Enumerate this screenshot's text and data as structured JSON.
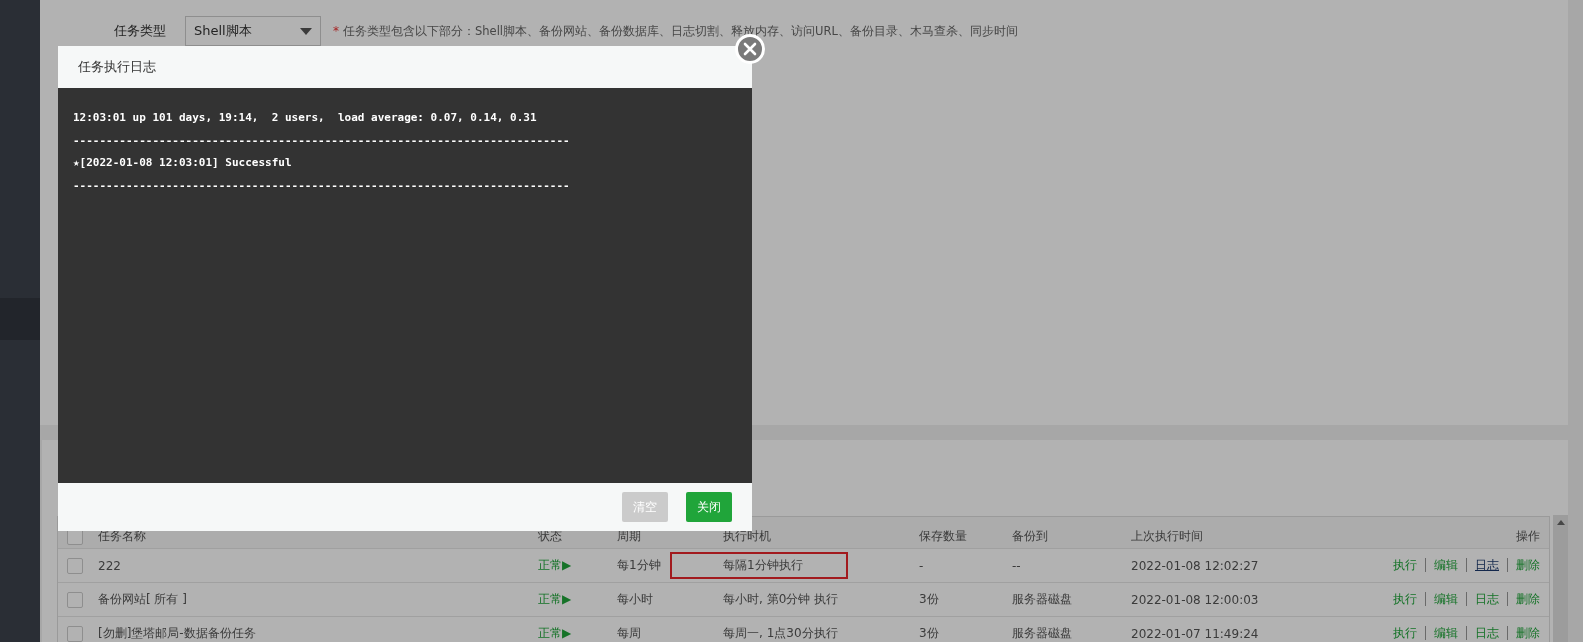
{
  "form": {
    "label": "任务类型",
    "select_value": "Shell脚本",
    "hint_mark": "*",
    "hint": "任务类型包含以下部分：Shell脚本、备份网站、备份数据库、日志切割、释放内存、访问URL、备份目录、木马查杀、同步时间"
  },
  "table": {
    "header_checked": false,
    "columns": [
      "任务名称",
      "状态",
      "周期",
      "执行时机",
      "保存数量",
      "备份到",
      "上次执行时间",
      "操作"
    ],
    "rows": [
      {
        "checked": false,
        "name": "222",
        "status": "正常▶",
        "period": "每1分钟",
        "timing": "每隔1分钟执行",
        "timing_highlighted": true,
        "count": "-",
        "target": "--",
        "last_run": "2022-01-08 12:02:27",
        "actions": [
          {
            "label": "执行",
            "hovered": false
          },
          {
            "label": "编辑",
            "hovered": false
          },
          {
            "label": "日志",
            "hovered": true
          },
          {
            "label": "删除",
            "hovered": false
          }
        ]
      },
      {
        "checked": false,
        "name": "备份网站[ 所有 ]",
        "status": "正常▶",
        "period": "每小时",
        "timing": "每小时, 第0分钟 执行",
        "timing_highlighted": false,
        "count": "3份",
        "target": "服务器磁盘",
        "last_run": "2022-01-08 12:00:03",
        "actions": [
          {
            "label": "执行",
            "hovered": false
          },
          {
            "label": "编辑",
            "hovered": false
          },
          {
            "label": "日志",
            "hovered": false
          },
          {
            "label": "删除",
            "hovered": false
          }
        ]
      },
      {
        "checked": false,
        "name": "[勿删]堡塔邮局-数据备份任务",
        "status": "正常▶",
        "period": "每周",
        "timing": "每周一, 1点30分执行",
        "timing_highlighted": false,
        "count": "3份",
        "target": "服务器磁盘",
        "last_run": "2022-01-07 11:49:24",
        "actions": [
          {
            "label": "执行",
            "hovered": false
          },
          {
            "label": "编辑",
            "hovered": false
          },
          {
            "label": "日志",
            "hovered": false
          },
          {
            "label": "删除",
            "hovered": false
          }
        ]
      }
    ]
  },
  "dialog": {
    "title": "任务执行日志",
    "log_lines": [
      "12:03:01 up 101 days, 19:14,  2 users,  load average: 0.07, 0.14, 0.31",
      "---------------------------------------------------------------------------",
      "★[2022-01-08 12:03:01] Successful",
      "---------------------------------------------------------------------------"
    ],
    "buttons": [
      {
        "label": "清空",
        "kind": "secondary"
      },
      {
        "label": "关闭",
        "kind": "primary"
      }
    ]
  }
}
